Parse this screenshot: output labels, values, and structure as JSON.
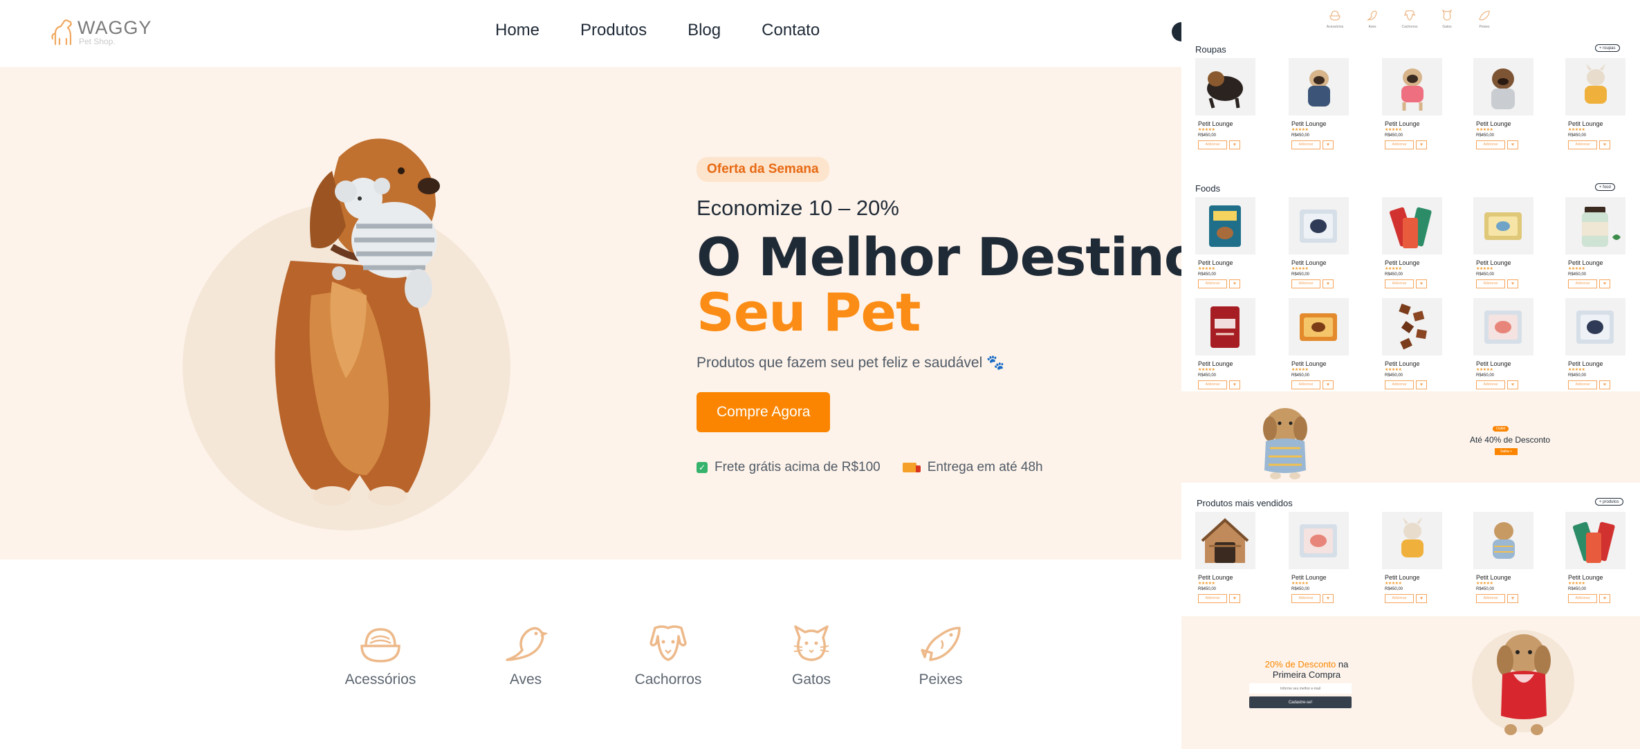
{
  "brand": {
    "name": "WAGGY",
    "tagline": "Pet Shop.",
    "accent": "#fb8500",
    "dark": "#1f2a37",
    "cream": "#fdf3ea"
  },
  "nav": {
    "items": [
      "Home",
      "Produtos",
      "Blog",
      "Contato"
    ]
  },
  "hero": {
    "badge": "Oferta da Semana",
    "subhead": "Economize 10 – 20%",
    "headline_dark": "O Melhor Destino Par",
    "headline_accent": "Seu Pet",
    "description": "Produtos que fazem seu pet feliz e saudável 🐾",
    "cta": "Compre Agora",
    "perk_shipping": "Frete grátis acima de R$100",
    "perk_delivery": "Entrega em até 48h"
  },
  "categories": [
    {
      "label": "Acessórios",
      "icon": "bowl-icon"
    },
    {
      "label": "Aves",
      "icon": "bird-icon"
    },
    {
      "label": "Cachorros",
      "icon": "dog-icon"
    },
    {
      "label": "Gatos",
      "icon": "cat-icon"
    },
    {
      "label": "Peixes",
      "icon": "fish-icon"
    }
  ],
  "preview": {
    "top_categories": [
      "Acessórios",
      "Aves",
      "Cachorros",
      "Gatos",
      "Peixes"
    ],
    "clothes": {
      "title": "Roupas",
      "more": "+ roupas"
    },
    "foods": {
      "title": "Foods",
      "more": "+ food"
    },
    "bestsellers": {
      "title": "Produtos mais vendidos",
      "more": "+ produtos"
    },
    "product": {
      "name": "Petit Lounge",
      "stars": "★★★★★",
      "price": "R$450,00",
      "add": "Adicionar",
      "cart": "♥"
    },
    "banner": {
      "badge": "Outlet",
      "title": "Até 40% de Desconto",
      "button": "Saiba +"
    },
    "promo": {
      "highlight": "20% de Desconto",
      "rest1": " na",
      "rest2": "Primeira Compra",
      "input_placeholder": "Informe seu melhor e-mail",
      "button": "Cadastre-se!"
    }
  }
}
